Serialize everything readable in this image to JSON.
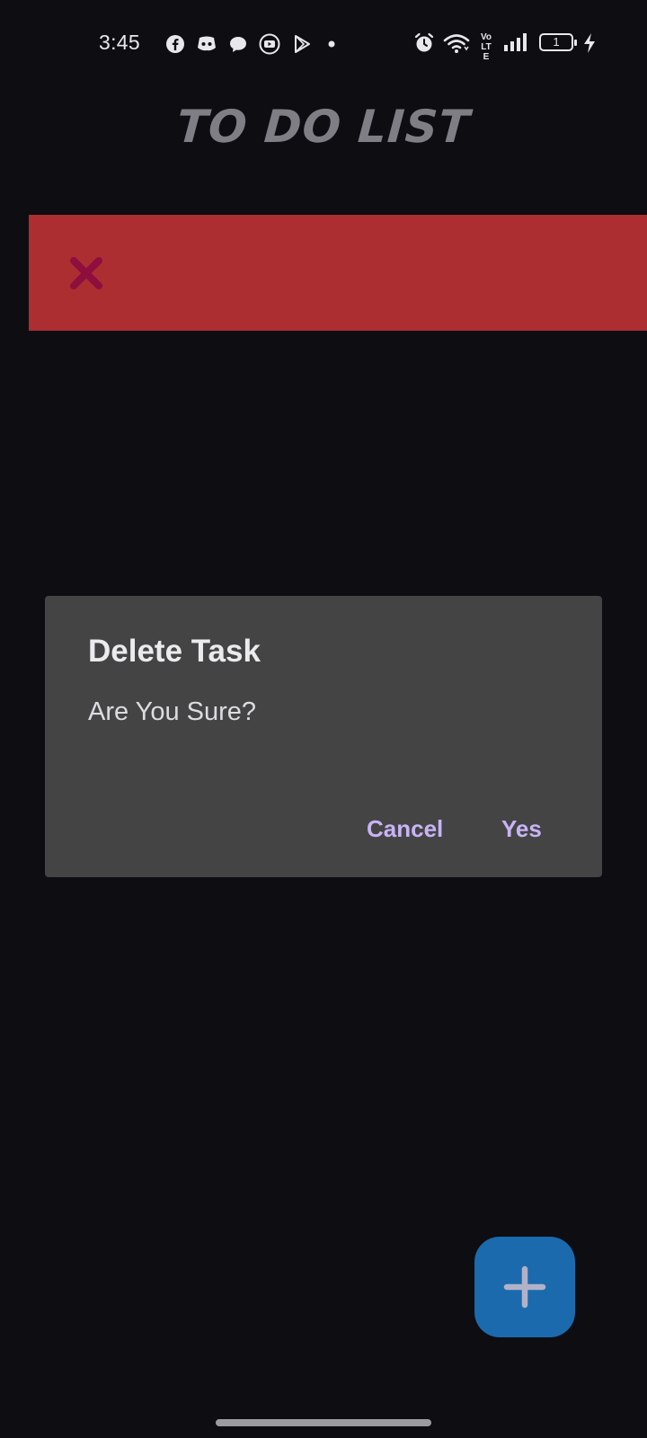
{
  "status_bar": {
    "time": "3:45",
    "battery_level": "1",
    "network_label": "Vo LTE",
    "notification_icons": [
      "facebook-icon",
      "discord-icon",
      "chat-icon",
      "youtube-icon",
      "play-store-icon",
      "dot-icon"
    ],
    "system_icons": [
      "alarm-icon",
      "wifi-icon",
      "volte-icon",
      "signal-icon",
      "battery-icon",
      "charging-icon"
    ]
  },
  "app": {
    "title": "TO DO LIST"
  },
  "task_row": {
    "swipe_action_icon": "close-icon",
    "background_color": "#ac2e31"
  },
  "dialog": {
    "title": "Delete Task",
    "message": "Are You Sure?",
    "cancel_label": "Cancel",
    "confirm_label": "Yes",
    "button_color": "#c8b4f4"
  },
  "fab": {
    "icon": "plus-icon",
    "color": "#1b6aad"
  }
}
